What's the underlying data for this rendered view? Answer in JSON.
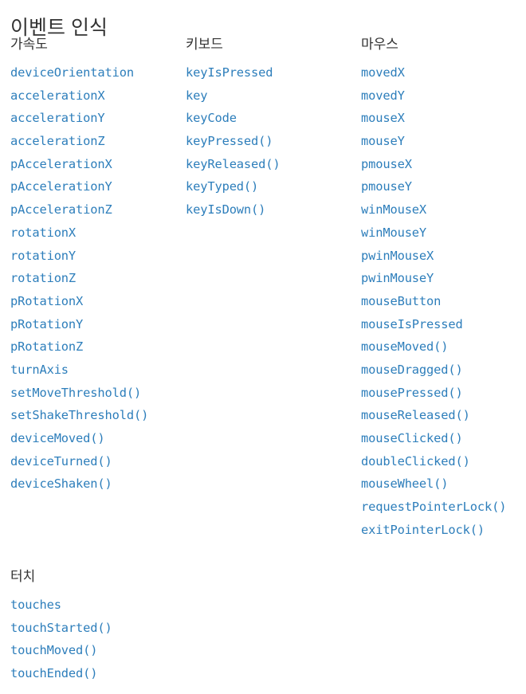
{
  "page": {
    "title": "이벤트 인식",
    "link_color": "#2d7ebb",
    "heading_color": "#333333",
    "background_color": "#ffffff"
  },
  "columns": [
    {
      "heading": "가속도",
      "items": [
        "deviceOrientation",
        "accelerationX",
        "accelerationY",
        "accelerationZ",
        "pAccelerationX",
        "pAccelerationY",
        "pAccelerationZ",
        "rotationX",
        "rotationY",
        "rotationZ",
        "pRotationX",
        "pRotationY",
        "pRotationZ",
        "turnAxis",
        "setMoveThreshold()",
        "setShakeThreshold()",
        "deviceMoved()",
        "deviceTurned()",
        "deviceShaken()"
      ]
    },
    {
      "heading": "키보드",
      "items": [
        "keyIsPressed",
        "key",
        "keyCode",
        "keyPressed()",
        "keyReleased()",
        "keyTyped()",
        "keyIsDown()"
      ]
    },
    {
      "heading": "마우스",
      "items": [
        "movedX",
        "movedY",
        "mouseX",
        "mouseY",
        "pmouseX",
        "pmouseY",
        "winMouseX",
        "winMouseY",
        "pwinMouseX",
        "pwinMouseY",
        "mouseButton",
        "mouseIsPressed",
        "mouseMoved()",
        "mouseDragged()",
        "mousePressed()",
        "mouseReleased()",
        "mouseClicked()",
        "doubleClicked()",
        "mouseWheel()",
        "requestPointerLock()",
        "exitPointerLock()"
      ]
    }
  ],
  "second_row": [
    {
      "heading": "터치",
      "items": [
        "touches",
        "touchStarted()",
        "touchMoved()",
        "touchEnded()"
      ]
    }
  ]
}
